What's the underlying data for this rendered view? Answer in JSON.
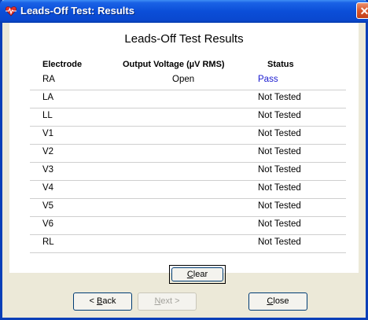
{
  "window": {
    "title": "Leads-Off Test: Results",
    "close_glyph": "✕"
  },
  "heading": "Leads-Off Test Results",
  "table": {
    "columns": [
      "Electrode",
      "Output Voltage (µV RMS)",
      "Status"
    ],
    "rows": [
      {
        "electrode": "RA",
        "voltage": "Open",
        "status": "Pass"
      },
      {
        "electrode": "LA",
        "voltage": "",
        "status": "Not Tested"
      },
      {
        "electrode": "LL",
        "voltage": "",
        "status": "Not Tested"
      },
      {
        "electrode": "V1",
        "voltage": "",
        "status": "Not Tested"
      },
      {
        "electrode": "V2",
        "voltage": "",
        "status": "Not Tested"
      },
      {
        "electrode": "V3",
        "voltage": "",
        "status": "Not Tested"
      },
      {
        "electrode": "V4",
        "voltage": "",
        "status": "Not Tested"
      },
      {
        "electrode": "V5",
        "voltage": "",
        "status": "Not Tested"
      },
      {
        "electrode": "V6",
        "voltage": "",
        "status": "Not Tested"
      },
      {
        "electrode": "RL",
        "voltage": "",
        "status": "Not Tested"
      }
    ]
  },
  "buttons": {
    "clear": {
      "mnemonic": "C",
      "rest": "lear"
    },
    "back": {
      "prefix": "< ",
      "mnemonic": "B",
      "rest": "ack"
    },
    "next": {
      "mnemonic": "N",
      "rest": "ext >"
    },
    "close": {
      "mnemonic": "C",
      "rest": "lose"
    }
  },
  "colors": {
    "title_bar": "#0b4ed8",
    "pass_text": "#1a1ad0",
    "window_bg": "#ece9d8"
  },
  "icons": {
    "app": "heart-pulse-icon",
    "close": "close-icon"
  }
}
